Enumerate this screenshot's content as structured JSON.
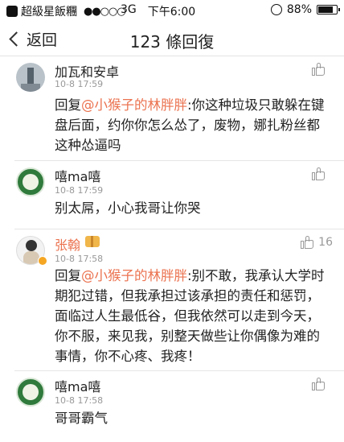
{
  "status_bar": {
    "carrier": "超級星飯糰",
    "signal_dots": "●●○○○",
    "network": "3G",
    "time": "下午6:00",
    "battery": "88%",
    "battery_level": 0.88
  },
  "nav": {
    "back_label": "返回",
    "title": "123 條回復"
  },
  "comments": [
    {
      "name": "加瓦和安卓",
      "time": "10-8 17:59",
      "reply_prefix": "回复",
      "mention": "@小猴子的林胖胖",
      "text": ":你这种垃圾只敢躲在键盘后面，约你你怎么怂了，废物，娜扎粉丝都这种怂逼吗",
      "likes": ""
    },
    {
      "name": "嘻ma嘻",
      "time": "10-8 17:59",
      "reply_prefix": "",
      "mention": "",
      "text": "别太屌，小心我哥让你哭",
      "likes": ""
    },
    {
      "name": "张翰",
      "time": "10-8 17:58",
      "reply_prefix": "回复",
      "mention": "@小猴子的林胖胖",
      "text": ":别不敢，我承认大学时期犯过错，但我承担过该承担的责任和惩罚，面临过人生最低谷，但我依然可以走到今天，你不服，来见我，别整天做些让你偶像为难的事情，你不心疼、我疼！",
      "likes": "16"
    },
    {
      "name": "嘻ma嘻",
      "time": "10-8 17:58",
      "reply_prefix": "",
      "mention": "",
      "text": "哥哥霸气",
      "likes": ""
    }
  ],
  "colors": {
    "mention": "#eb7350",
    "meta_gray": "#999999",
    "verified_badge": "#f5a623"
  }
}
